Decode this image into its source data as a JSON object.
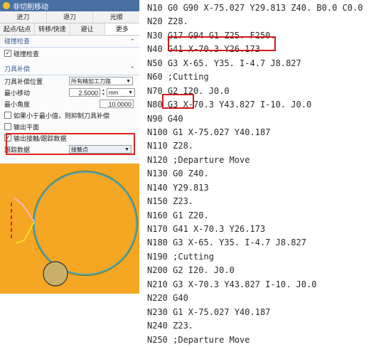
{
  "window": {
    "title": "非切削移动"
  },
  "tabs_row1": [
    "进刀",
    "退刀",
    "光顺"
  ],
  "tabs_row2": [
    "起点/钻点",
    "转移/快速",
    "避让",
    "更多"
  ],
  "sections": {
    "collision": {
      "title": "碰撞检查",
      "checkbox_label": "碰撞检查",
      "checked": true
    },
    "tool_comp": {
      "title": "刀具补偿",
      "position_label": "刀具补偿位置",
      "position_value": "所有精加工刀路",
      "min_move_label": "最小移动",
      "min_move_value": "2.5000",
      "min_move_unit": "mm",
      "min_angle_label": "最小角度",
      "min_angle_value": "10.0000",
      "suppress_label": "如果小于最小值，则抑制刀具补偿",
      "suppress_checked": false,
      "output_plane_label": "输出平面",
      "output_plane_checked": false,
      "output_contact_label": "输出接触/跟踪数据",
      "output_contact_checked": true,
      "tracking_label": "跟踪数据",
      "tracking_value": "接触点"
    }
  },
  "code_lines": [
    "N10 G0 G90 X-75.027 Y29.813 Z40. B0.0 C0.0",
    "N20 Z28.",
    "N30 G17 G94 G1 Z25. F250.",
    "N40 G41 X-70.3 Y26.173",
    "N50 G3 X-65. Y35. I-4.7 J8.827",
    "N60 ;Cutting",
    "N70 G2 I20. J0.0",
    "N80 G3 X-70.3 Y43.827 I-10. J0.0",
    "N90 G40",
    "N100 G1 X-75.027 Y40.187",
    "N110 Z28.",
    "N120 ;Departure Move",
    "N130 G0 Z40.",
    "N140 Y29.813",
    "N150 Z23.",
    "N160 G1 Z20.",
    "N170 G41 X-70.3 Y26.173",
    "N180 G3 X-65. Y35. I-4.7 J8.827",
    "N190 ;Cutting",
    "N200 G2 I20. J0.0",
    "N210 G3 X-70.3 Y43.827 I-10. J0.0",
    "N220 G40",
    "N230 G1 X-75.027 Y40.187",
    "N240 Z23.",
    "N250 ;Departure Move"
  ],
  "colors": {
    "highlight": "#d01818",
    "drawing_bg": "#f5a623",
    "panel_header": "#4a6fa3"
  }
}
